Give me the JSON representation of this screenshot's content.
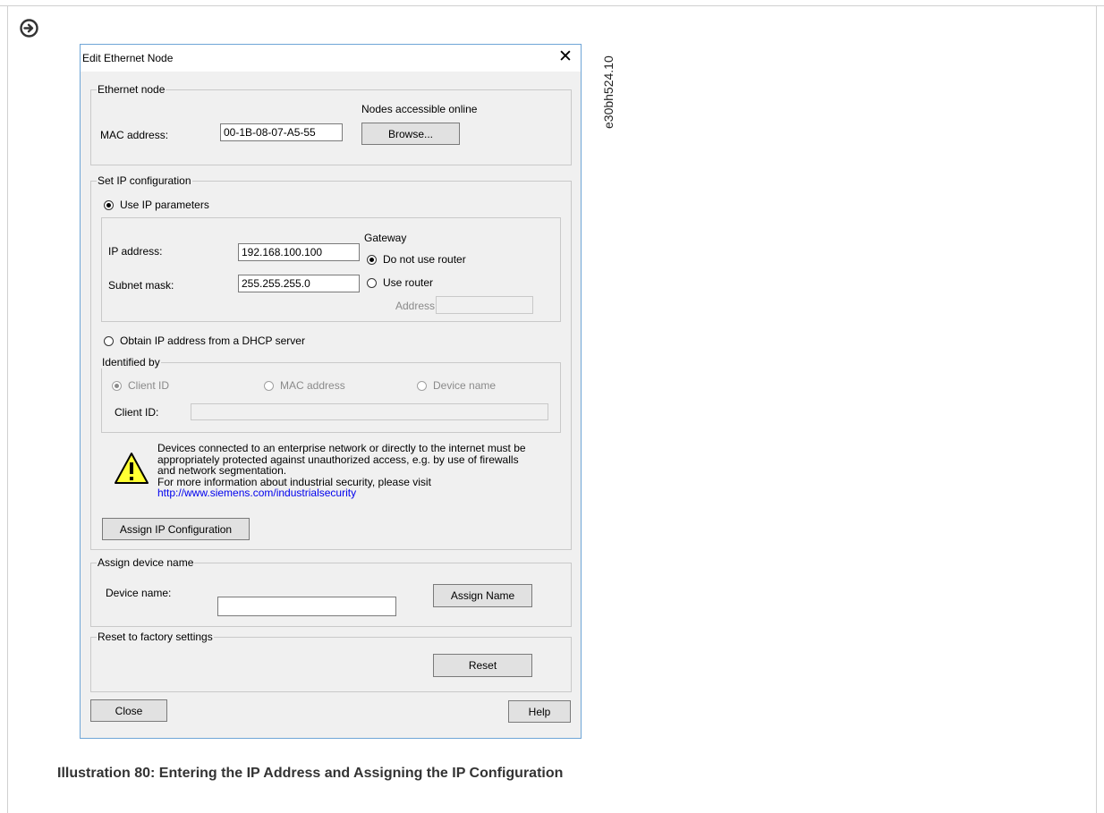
{
  "doc_id": "e30bh524.10",
  "caption": "Illustration 80: Entering the IP Address and Assigning the IP Configuration",
  "icons": {
    "arrow": "arrow-circle-right-icon",
    "warning": "warning-triangle-icon",
    "close": "close-icon"
  },
  "dialog": {
    "title": "Edit Ethernet Node",
    "close_glyph": "✕",
    "ethernet_node": {
      "legend": "Ethernet node",
      "mac_label": "MAC address:",
      "mac_value": "00-1B-08-07-A5-55",
      "nodes_label": "Nodes accessible online",
      "browse_button": "Browse..."
    },
    "ip_config": {
      "legend": "Set IP configuration",
      "use_ip_label": "Use IP parameters",
      "ip_label": "IP address:",
      "ip_value": "192.168.100.100",
      "subnet_label": "Subnet mask:",
      "subnet_value": "255.255.255.0",
      "gateway_label": "Gateway",
      "no_router_label": "Do not use router",
      "use_router_label": "Use router",
      "address_label": "Address:",
      "dhcp_label": "Obtain IP address from a DHCP server",
      "identified_legend": "Identified by",
      "client_id_option": "Client ID",
      "mac_option": "MAC address",
      "device_name_option": "Device name",
      "client_id_label": "Client ID:",
      "warning_lines": [
        "Devices connected to an enterprise network or directly to the internet must be",
        "appropriately protected against unauthorized access, e.g. by use of firewalls",
        "and network segmentation.",
        "For more information about industrial security, please visit"
      ],
      "warning_link": "http://www.siemens.com/industrialsecurity",
      "assign_ip_button": "Assign IP Configuration"
    },
    "device_name": {
      "legend": "Assign device name",
      "label": "Device name:",
      "value": "",
      "assign_button": "Assign Name"
    },
    "reset": {
      "legend": "Reset to factory settings",
      "button": "Reset"
    },
    "close_button": "Close",
    "help_button": "Help"
  }
}
